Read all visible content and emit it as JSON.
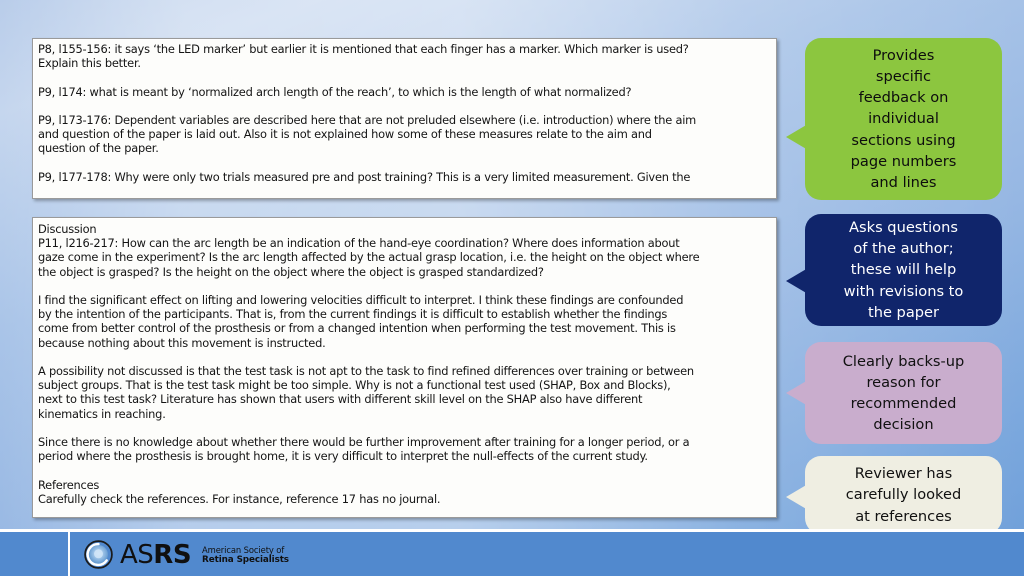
{
  "slide": {
    "background_top": "#c0d2ec",
    "background_bottom": "#6d9ed9"
  },
  "panels": [
    {
      "name": "review-comments-methods",
      "text": "P8, l155-156: it says ‘the LED marker’ but earlier it is mentioned that each finger has a marker. Which marker is used?\nExplain this better.\n\nP9, l174: what is meant by ‘normalized arch length of the reach’, to which is the length of what normalized?\n\nP9, l173-176: Dependent variables are described here that are not preluded elsewhere (i.e. introduction) where the aim\nand question of the paper is laid out. Also it is not explained how some of these measures relate to the aim and\nquestion of the paper.\n\nP9, l177-178: Why were only two trials measured pre and post training? This is a very limited measurement. Given the"
    },
    {
      "name": "review-comments-discussion",
      "text": "Discussion\nP11, l216-217: How can the arc length be an indication of the hand-eye coordination? Where does information about\ngaze come in the experiment? Is the arc length affected by the actual grasp location, i.e. the height on the object where\nthe object is grasped? Is the height on the object where the object is grasped standardized?\n\nI find the significant effect on lifting and lowering velocities difficult to interpret. I think these findings are confounded\nby the intention of the participants. That is, from the current findings it is difficult to establish whether the findings\ncome from better control of the prosthesis or from a changed intention when performing the test movement. This is\nbecause nothing about this movement is instructed.\n\nA possibility not discussed is that the test task is not apt to the task to find refined differences over training or between\nsubject groups. That is the test task might be too simple. Why is not a functional test used (SHAP, Box and Blocks),\nnext to this test task? Literature has shown that users with different skill level on the SHAP also have different\nkinematics in reaching.\n\nSince there is no knowledge about whether there would be further improvement after training for a longer period, or a\nperiod where the prosthesis is brought home, it is very difficult to interpret the null-effects of the current study.\n\nReferences\nCarefully check the references. For instance, reference 17 has no journal."
    }
  ],
  "callouts": [
    {
      "name": "callout-specific-feedback",
      "text": "Provides\nspecific\nfeedback on\nindividual\nsections using\npage numbers\nand lines",
      "fill": "#8CC63F",
      "text_color": "#0d0d0d"
    },
    {
      "name": "callout-asks-questions",
      "text": "Asks questions\nof the author;\nthese will help\nwith revisions to\nthe paper",
      "fill": "#10256B",
      "text_color": "#ffffff"
    },
    {
      "name": "callout-backs-up-decision",
      "text": "Clearly backs-up\nreason for\nrecommended\ndecision",
      "fill": "#C9ADCD",
      "text_color": "#111111"
    },
    {
      "name": "callout-checked-references",
      "text": "Reviewer has\ncarefully looked\nat references",
      "fill": "#EFEEE2",
      "text_color": "#111111"
    }
  ],
  "footer": {
    "bar_color": "#5189CE",
    "logo": {
      "acronym_light": "AS",
      "acronym_heavy": "RS",
      "line1": "American Society of",
      "line2": "Retina Specialists"
    }
  }
}
